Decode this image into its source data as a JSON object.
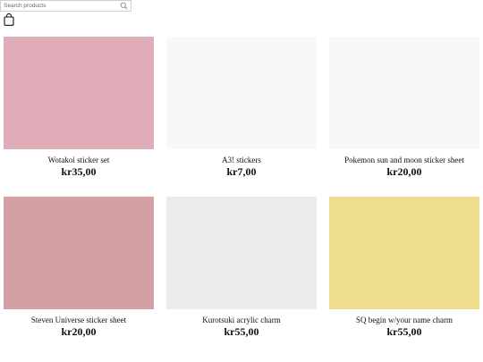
{
  "search": {
    "placeholder": "Search products",
    "value": ""
  },
  "icons": {
    "search": "search-icon",
    "cart": "shopping-bag-icon"
  },
  "products": [
    {
      "title": "Wotakoi sticker set",
      "price": "kr35,00",
      "image_color": "#dfacb8"
    },
    {
      "title": "A3! stickers",
      "price": "kr7,00",
      "image_color": "#f8f8f8"
    },
    {
      "title": "Pokemon sun and moon sticker sheet",
      "price": "kr20,00",
      "image_color": "#f8f8f8"
    },
    {
      "title": "Steven Universe sticker sheet",
      "price": "kr20,00",
      "image_color": "#d4a0a4"
    },
    {
      "title": "Kurotsuki acrylic charm",
      "price": "kr55,00",
      "image_color": "#ececec"
    },
    {
      "title": "SQ begin w/your name charm",
      "price": "kr55,00",
      "image_color": "#eedd8e"
    }
  ]
}
